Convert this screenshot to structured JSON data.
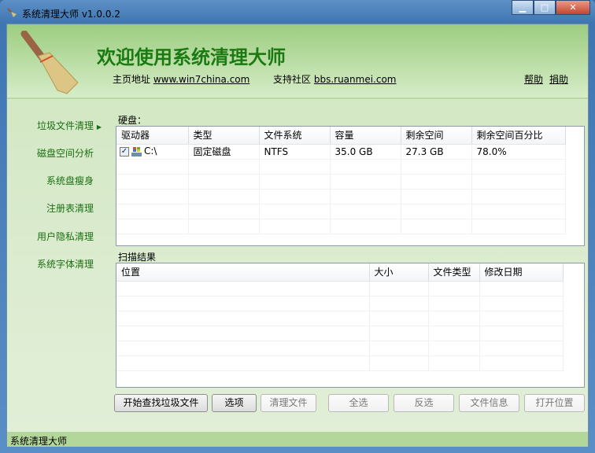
{
  "window": {
    "title": "系统清理大师 v1.0.0.2",
    "minimize": "▁",
    "maximize": "□",
    "close": "✕"
  },
  "header": {
    "title": "欢迎使用系统清理大师",
    "homepage_label": "主页地址",
    "homepage_link": "www.win7china.com",
    "community_label": "支持社区",
    "community_link": "bbs.ruanmei.com",
    "help": "帮助",
    "donate": "捐助"
  },
  "nav": [
    {
      "label": "垃圾文件清理",
      "arrow": "▶"
    },
    {
      "label": "磁盘空间分析"
    },
    {
      "label": "系统盘瘦身"
    },
    {
      "label": "注册表清理"
    },
    {
      "label": "用户隐私清理"
    },
    {
      "label": "系统字体清理"
    }
  ],
  "disk": {
    "label": "硬盘：",
    "columns": [
      "驱动器",
      "类型",
      "文件系统",
      "容量",
      "剩余空间",
      "剩余空间百分比"
    ],
    "rows": [
      {
        "checked": "✓",
        "drive": "C:\\",
        "type": "固定磁盘",
        "fs": "NTFS",
        "capacity": "35.0 GB",
        "free": "27.3 GB",
        "percent": "78.0%"
      }
    ]
  },
  "scan": {
    "label": "扫描结果",
    "columns": [
      "位置",
      "大小",
      "文件类型",
      "修改日期"
    ]
  },
  "buttons": {
    "start": "开始查找垃圾文件",
    "options": "选项",
    "clean": "清理文件",
    "select_all": "全选",
    "invert": "反选",
    "file_info": "文件信息",
    "open_location": "打开位置"
  },
  "status": "系统清理大师"
}
